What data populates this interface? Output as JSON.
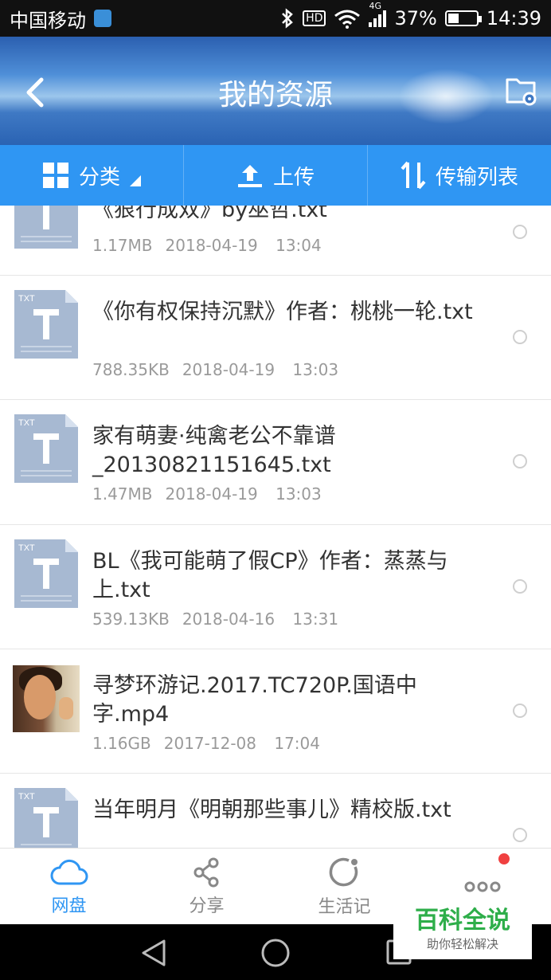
{
  "status_bar": {
    "carrier": "中国移动",
    "hd": "HD",
    "network": "4G",
    "battery": "37%",
    "battery_level": 0.37,
    "time": "14:39"
  },
  "header": {
    "title": "我的资源"
  },
  "toolbar": {
    "category_label": "分类",
    "upload_label": "上传",
    "transfer_label": "传输列表"
  },
  "files": [
    {
      "name": "《狠行成双》by巫哲.txt",
      "size": "1.17MB",
      "date": "2018-04-19",
      "time": "13:04",
      "type": "txt"
    },
    {
      "name": "《你有权保持沉默》作者：桃桃一轮.txt",
      "size": "788.35KB",
      "date": "2018-04-19",
      "time": "13:03",
      "type": "txt"
    },
    {
      "name": "家有萌妻·纯禽老公不靠谱_20130821151645.txt",
      "size": "1.47MB",
      "date": "2018-04-19",
      "time": "13:03",
      "type": "txt"
    },
    {
      "name": "BL《我可能萌了假CP》作者：蒸蒸与上.txt",
      "size": "539.13KB",
      "date": "2018-04-16",
      "time": "13:31",
      "type": "txt"
    },
    {
      "name": "寻梦环游记.2017.TC720P.国语中字.mp4",
      "size": "1.16GB",
      "date": "2017-12-08",
      "time": "17:04",
      "type": "video"
    },
    {
      "name": "当年明月《明朝那些事儿》精校版.txt",
      "size": "",
      "date": "",
      "time": "",
      "type": "txt"
    }
  ],
  "file_type_label": "TXT",
  "bottom_nav": {
    "cloud": "网盘",
    "share": "分享",
    "life": "生活记"
  },
  "watermark": {
    "title": "百科全说",
    "subtitle": "助你轻松解决"
  },
  "colors": {
    "accent": "#2f96f3",
    "notification": "#f04040",
    "watermark": "#2eae4a"
  }
}
